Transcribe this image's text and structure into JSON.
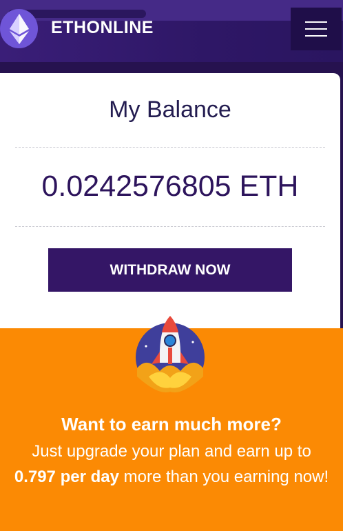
{
  "header": {
    "brand": "ETHONLINE",
    "logo_icon": "ethereum-diamond-icon",
    "menu_icon": "hamburger-menu-icon"
  },
  "balance_card": {
    "title": "My Balance",
    "amount": "0.0242576805 ETH",
    "withdraw_label": "WITHDRAW NOW"
  },
  "promo": {
    "icon": "rocket-icon",
    "headline": "Want to earn much more?",
    "line_intro": "Just upgrade your plan and earn up to",
    "highlight": "0.797 per day",
    "line_outro": "more than you earning now!"
  },
  "colors": {
    "header_bg": "#2e1766",
    "accent_purple": "#341666",
    "promo_orange": "#fb8a04"
  }
}
